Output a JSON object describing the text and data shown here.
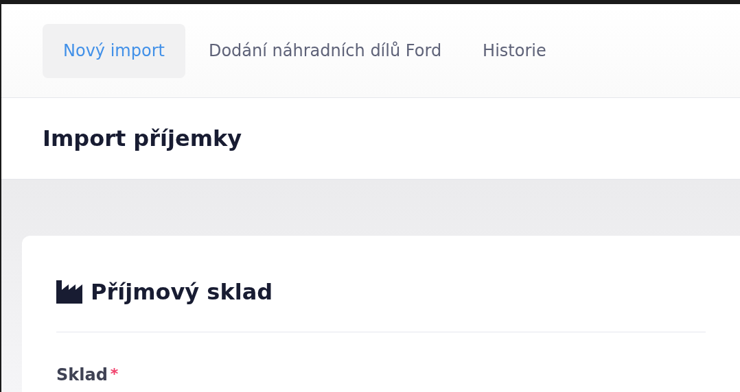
{
  "tabs": [
    {
      "label": "Nový import",
      "selected": true
    },
    {
      "label": "Dodání náhradních dílů Ford",
      "selected": false
    },
    {
      "label": "Historie",
      "selected": false
    }
  ],
  "page_title": "Import příjemky",
  "section": {
    "title": "Příjmový sklad",
    "fields": [
      {
        "label": "Sklad",
        "required_mark": "*"
      }
    ]
  }
}
